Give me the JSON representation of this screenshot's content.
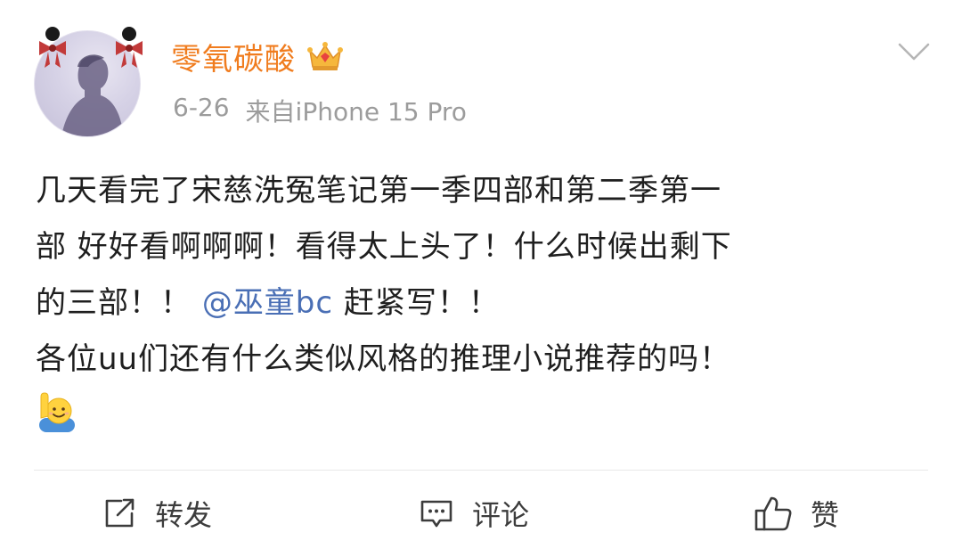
{
  "user": {
    "name": "零氧碳酸",
    "badge_icon": "crown-icon",
    "date": "6-26",
    "source": "来自iPhone 15 Pro"
  },
  "post": {
    "line1": "几天看完了宋慈洗冤笔记第一季四部和第二季第一",
    "line2": "部  好好看啊啊啊！看得太上头了！什么时候出剩下",
    "line3_before": "的三部！！",
    "mention": "@巫童bc",
    "line3_after": "赶紧写！！",
    "line4": "各位uu们还有什么类似风格的推理小说推荐的吗！",
    "emoji": "raising-hand-emoji"
  },
  "actions": {
    "repost_label": "转发",
    "comment_label": "评论",
    "like_label": "赞"
  },
  "colors": {
    "username": "#f07c1e",
    "meta": "#9c9c9c",
    "mention": "#4a6fb5",
    "text": "#1f1f1f",
    "divider": "#e8e8e8"
  }
}
